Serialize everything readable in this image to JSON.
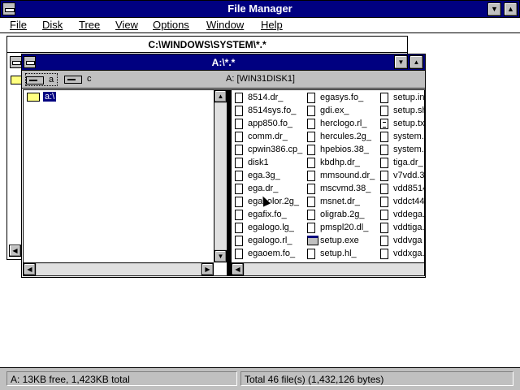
{
  "app": {
    "title": "File Manager",
    "minimize_glyph": "▼",
    "maximize_glyph": "▲"
  },
  "menu": [
    {
      "label": "File"
    },
    {
      "label": "Disk"
    },
    {
      "label": "Tree"
    },
    {
      "label": "View"
    },
    {
      "label": "Options"
    },
    {
      "label": "Window"
    },
    {
      "label": "Help"
    }
  ],
  "back_window": {
    "title": "C:\\WINDOWS\\SYSTEM\\*.*"
  },
  "front_window": {
    "title": "A:\\*.*",
    "drives": [
      {
        "letter": "a",
        "selected": true
      },
      {
        "letter": "c",
        "selected": false
      }
    ],
    "volume_label": "A: [WIN31DISK1]",
    "tree": {
      "root_label": "a:\\"
    },
    "files": {
      "column1": [
        "8514.dr_",
        "8514sys.fo_",
        "app850.fo_",
        "comm.dr_",
        "cpwin386.cp_",
        "disk1",
        "ega.3g_",
        "ega.dr_",
        "egacolor.2g_",
        "egafix.fo_",
        "egalogo.lg_",
        "egalogo.rl_",
        "egaoem.fo_"
      ],
      "column2": [
        "egasys.fo_",
        "gdi.ex_",
        "herclogo.rl_",
        "hercules.2g_",
        "hpebios.38_",
        "kbdhp.dr_",
        "mmsound.dr_",
        "mscvmd.38_",
        "msnet.dr_",
        "oligrab.2g_",
        "pmspl20.dl_",
        "setup.exe",
        "setup.hl_"
      ],
      "column3": [
        "setup.in",
        "setup.sh",
        "setup.tx",
        "system.c",
        "system.s",
        "tiga.dr_",
        "v7vdd.3",
        "vdd8514",
        "vddct44",
        "vddega.",
        "vddtiga.",
        "vddvga",
        "vddxga."
      ]
    }
  },
  "status": {
    "left": "A: 13KB free,  1,423KB total",
    "right": "Total 46 file(s) (1,432,126 bytes)"
  },
  "colors": {
    "title_active": "#000080",
    "window_frame": "#c0c0c0",
    "selection": "#000080"
  }
}
